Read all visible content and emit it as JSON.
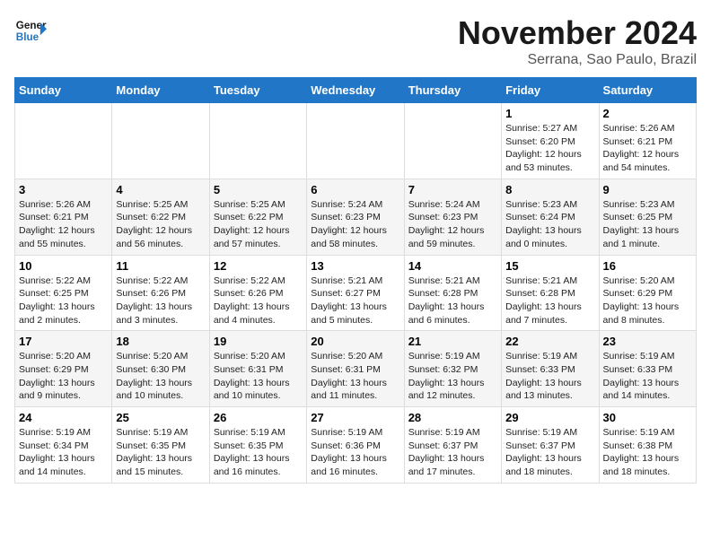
{
  "header": {
    "logo_line1": "General",
    "logo_line2": "Blue",
    "title": "November 2024",
    "subtitle": "Serrana, Sao Paulo, Brazil"
  },
  "days_of_week": [
    "Sunday",
    "Monday",
    "Tuesday",
    "Wednesday",
    "Thursday",
    "Friday",
    "Saturday"
  ],
  "weeks": [
    [
      {
        "day": "",
        "text": ""
      },
      {
        "day": "",
        "text": ""
      },
      {
        "day": "",
        "text": ""
      },
      {
        "day": "",
        "text": ""
      },
      {
        "day": "",
        "text": ""
      },
      {
        "day": "1",
        "text": "Sunrise: 5:27 AM\nSunset: 6:20 PM\nDaylight: 12 hours\nand 53 minutes."
      },
      {
        "day": "2",
        "text": "Sunrise: 5:26 AM\nSunset: 6:21 PM\nDaylight: 12 hours\nand 54 minutes."
      }
    ],
    [
      {
        "day": "3",
        "text": "Sunrise: 5:26 AM\nSunset: 6:21 PM\nDaylight: 12 hours\nand 55 minutes."
      },
      {
        "day": "4",
        "text": "Sunrise: 5:25 AM\nSunset: 6:22 PM\nDaylight: 12 hours\nand 56 minutes."
      },
      {
        "day": "5",
        "text": "Sunrise: 5:25 AM\nSunset: 6:22 PM\nDaylight: 12 hours\nand 57 minutes."
      },
      {
        "day": "6",
        "text": "Sunrise: 5:24 AM\nSunset: 6:23 PM\nDaylight: 12 hours\nand 58 minutes."
      },
      {
        "day": "7",
        "text": "Sunrise: 5:24 AM\nSunset: 6:23 PM\nDaylight: 12 hours\nand 59 minutes."
      },
      {
        "day": "8",
        "text": "Sunrise: 5:23 AM\nSunset: 6:24 PM\nDaylight: 13 hours\nand 0 minutes."
      },
      {
        "day": "9",
        "text": "Sunrise: 5:23 AM\nSunset: 6:25 PM\nDaylight: 13 hours\nand 1 minute."
      }
    ],
    [
      {
        "day": "10",
        "text": "Sunrise: 5:22 AM\nSunset: 6:25 PM\nDaylight: 13 hours\nand 2 minutes."
      },
      {
        "day": "11",
        "text": "Sunrise: 5:22 AM\nSunset: 6:26 PM\nDaylight: 13 hours\nand 3 minutes."
      },
      {
        "day": "12",
        "text": "Sunrise: 5:22 AM\nSunset: 6:26 PM\nDaylight: 13 hours\nand 4 minutes."
      },
      {
        "day": "13",
        "text": "Sunrise: 5:21 AM\nSunset: 6:27 PM\nDaylight: 13 hours\nand 5 minutes."
      },
      {
        "day": "14",
        "text": "Sunrise: 5:21 AM\nSunset: 6:28 PM\nDaylight: 13 hours\nand 6 minutes."
      },
      {
        "day": "15",
        "text": "Sunrise: 5:21 AM\nSunset: 6:28 PM\nDaylight: 13 hours\nand 7 minutes."
      },
      {
        "day": "16",
        "text": "Sunrise: 5:20 AM\nSunset: 6:29 PM\nDaylight: 13 hours\nand 8 minutes."
      }
    ],
    [
      {
        "day": "17",
        "text": "Sunrise: 5:20 AM\nSunset: 6:29 PM\nDaylight: 13 hours\nand 9 minutes."
      },
      {
        "day": "18",
        "text": "Sunrise: 5:20 AM\nSunset: 6:30 PM\nDaylight: 13 hours\nand 10 minutes."
      },
      {
        "day": "19",
        "text": "Sunrise: 5:20 AM\nSunset: 6:31 PM\nDaylight: 13 hours\nand 10 minutes."
      },
      {
        "day": "20",
        "text": "Sunrise: 5:20 AM\nSunset: 6:31 PM\nDaylight: 13 hours\nand 11 minutes."
      },
      {
        "day": "21",
        "text": "Sunrise: 5:19 AM\nSunset: 6:32 PM\nDaylight: 13 hours\nand 12 minutes."
      },
      {
        "day": "22",
        "text": "Sunrise: 5:19 AM\nSunset: 6:33 PM\nDaylight: 13 hours\nand 13 minutes."
      },
      {
        "day": "23",
        "text": "Sunrise: 5:19 AM\nSunset: 6:33 PM\nDaylight: 13 hours\nand 14 minutes."
      }
    ],
    [
      {
        "day": "24",
        "text": "Sunrise: 5:19 AM\nSunset: 6:34 PM\nDaylight: 13 hours\nand 14 minutes."
      },
      {
        "day": "25",
        "text": "Sunrise: 5:19 AM\nSunset: 6:35 PM\nDaylight: 13 hours\nand 15 minutes."
      },
      {
        "day": "26",
        "text": "Sunrise: 5:19 AM\nSunset: 6:35 PM\nDaylight: 13 hours\nand 16 minutes."
      },
      {
        "day": "27",
        "text": "Sunrise: 5:19 AM\nSunset: 6:36 PM\nDaylight: 13 hours\nand 16 minutes."
      },
      {
        "day": "28",
        "text": "Sunrise: 5:19 AM\nSunset: 6:37 PM\nDaylight: 13 hours\nand 17 minutes."
      },
      {
        "day": "29",
        "text": "Sunrise: 5:19 AM\nSunset: 6:37 PM\nDaylight: 13 hours\nand 18 minutes."
      },
      {
        "day": "30",
        "text": "Sunrise: 5:19 AM\nSunset: 6:38 PM\nDaylight: 13 hours\nand 18 minutes."
      }
    ]
  ]
}
